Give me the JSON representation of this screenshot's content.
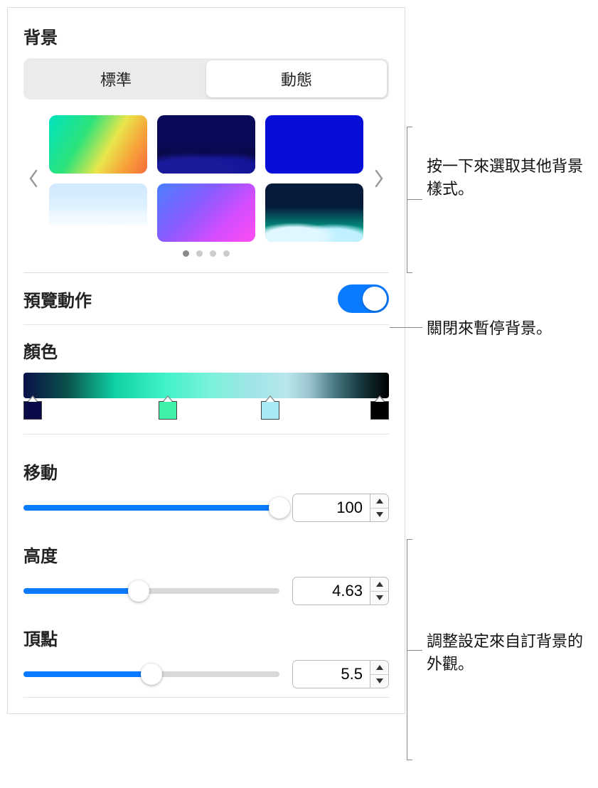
{
  "header": {
    "title": "背景"
  },
  "segmented": {
    "standard": "標準",
    "dynamic": "動態",
    "active": "dynamic"
  },
  "preview": {
    "label": "預覽動作",
    "on": true
  },
  "color": {
    "label": "顏色"
  },
  "sliders": {
    "move": {
      "label": "移動",
      "value": "100",
      "percent": 100
    },
    "height": {
      "label": "高度",
      "value": "4.63",
      "percent": 45
    },
    "top": {
      "label": "頂點",
      "value": "5.5",
      "percent": 50
    }
  },
  "callouts": {
    "pickBg": "按一下來選取其他背景樣式。",
    "toggle": "關閉來暫停背景。",
    "adjust": "調整設定來自訂背景的外觀。"
  }
}
